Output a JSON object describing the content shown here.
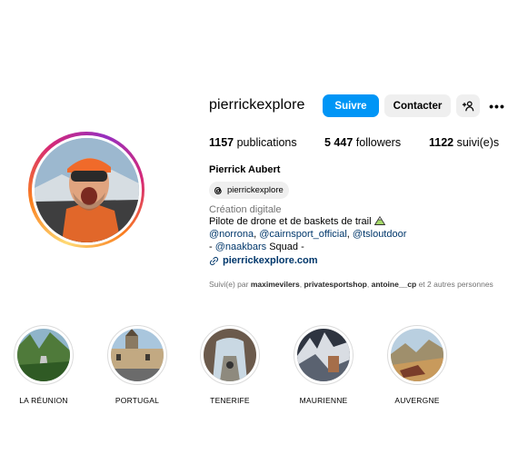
{
  "profile": {
    "username": "pierrickexplore",
    "follow_label": "Suivre",
    "contact_label": "Contacter",
    "more_label": "•••",
    "stats": {
      "posts_count": "1157",
      "posts_label": "publications",
      "followers_count": "5 447",
      "followers_label": "followers",
      "following_count": "1122",
      "following_label": "suivi(e)s"
    },
    "full_name": "Pierrick Aubert",
    "threads_handle": "pierrickexplore",
    "category": "Création digitale",
    "bio_line1": "Pilote de drone et de baskets de trail",
    "bio_mentions": [
      "@norrona",
      "@cairnsport_official",
      "@tsloutdoor"
    ],
    "bio_line3_prefix": "- ",
    "bio_line3_mention": "@naakbars",
    "bio_line3_suffix": " Squad -",
    "link": "pierrickexplore.com",
    "followed_by_prefix": "Suivi(e) par ",
    "followed_by_users": [
      "maximevilers",
      "privatesportshop",
      "antoine__cp"
    ],
    "followed_by_suffix": " et 2 autres personnes"
  },
  "highlights": [
    {
      "label": "LA RÉUNION"
    },
    {
      "label": "PORTUGAL"
    },
    {
      "label": "TENERIFE"
    },
    {
      "label": "MAURIENNE"
    },
    {
      "label": "AUVERGNE"
    }
  ],
  "colors": {
    "accent": "#0095f6",
    "link": "#00376b",
    "secondary_text": "#737373",
    "button_bg": "#efefef"
  }
}
